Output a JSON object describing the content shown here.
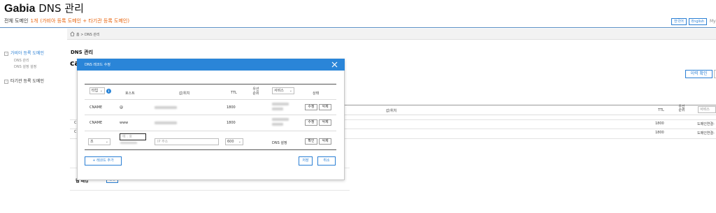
{
  "header": {
    "brand": "Gabia",
    "title": "DNS 관리",
    "all_domains_label": "전체 도메인",
    "domain_count": "1개",
    "count_note": "(가비아 등록 도메인 + 타기관 등록 도메인)",
    "lang_korean": "한국어",
    "lang_english": "English",
    "my_partial": "My"
  },
  "breadcrumb": {
    "home": "홈",
    "separator": ">",
    "current": "DNS 관리"
  },
  "sidebar": {
    "gabia_group": "가비아 등록 도메인",
    "gabia_items": [
      "DNS 관리",
      "DNS 설정 설정"
    ],
    "other_group": "타기관 등록 도메인"
  },
  "page": {
    "title": "DNS 관리",
    "domain_partial": "ca",
    "history_button": "이력 확인",
    "table_headers": {
      "value": "값/위치",
      "ttl": "TTL",
      "priority": "우선 순위",
      "service": "서비스"
    },
    "rows": [
      {
        "ttl": "1800",
        "service": "도메인연결-"
      },
      {
        "ttl": "1800",
        "service": "도메인연결-"
      }
    ],
    "web_forwarding_label": "웹 패킹",
    "web_forwarding_button": "설정"
  },
  "modal": {
    "title": "DNS 레코드 수정",
    "headers": {
      "type": "타입",
      "host": "호스트",
      "value": "값/위치",
      "ttl": "TTL",
      "priority": "우선 순위",
      "service": "서비스",
      "status": "상태"
    },
    "records": [
      {
        "type": "CNAME",
        "host": "@",
        "ttl": "1800",
        "edit": "수정",
        "delete": "삭제"
      },
      {
        "type": "CNAME",
        "host": "www",
        "ttl": "1800",
        "edit": "수정",
        "delete": "삭제"
      }
    ],
    "new_record": {
      "type": "조",
      "host_placeholder": "예 : 호",
      "value_placeholder": "IP 주소",
      "ttl": "600",
      "status": "DNS 설정",
      "confirm": "확인",
      "delete": "삭제"
    },
    "add_button": "+ 레코드 추가",
    "save_button": "저장",
    "cancel_button": "취소"
  },
  "colors": {
    "accent": "#2a85d8",
    "brand_orange": "#e8620a"
  }
}
